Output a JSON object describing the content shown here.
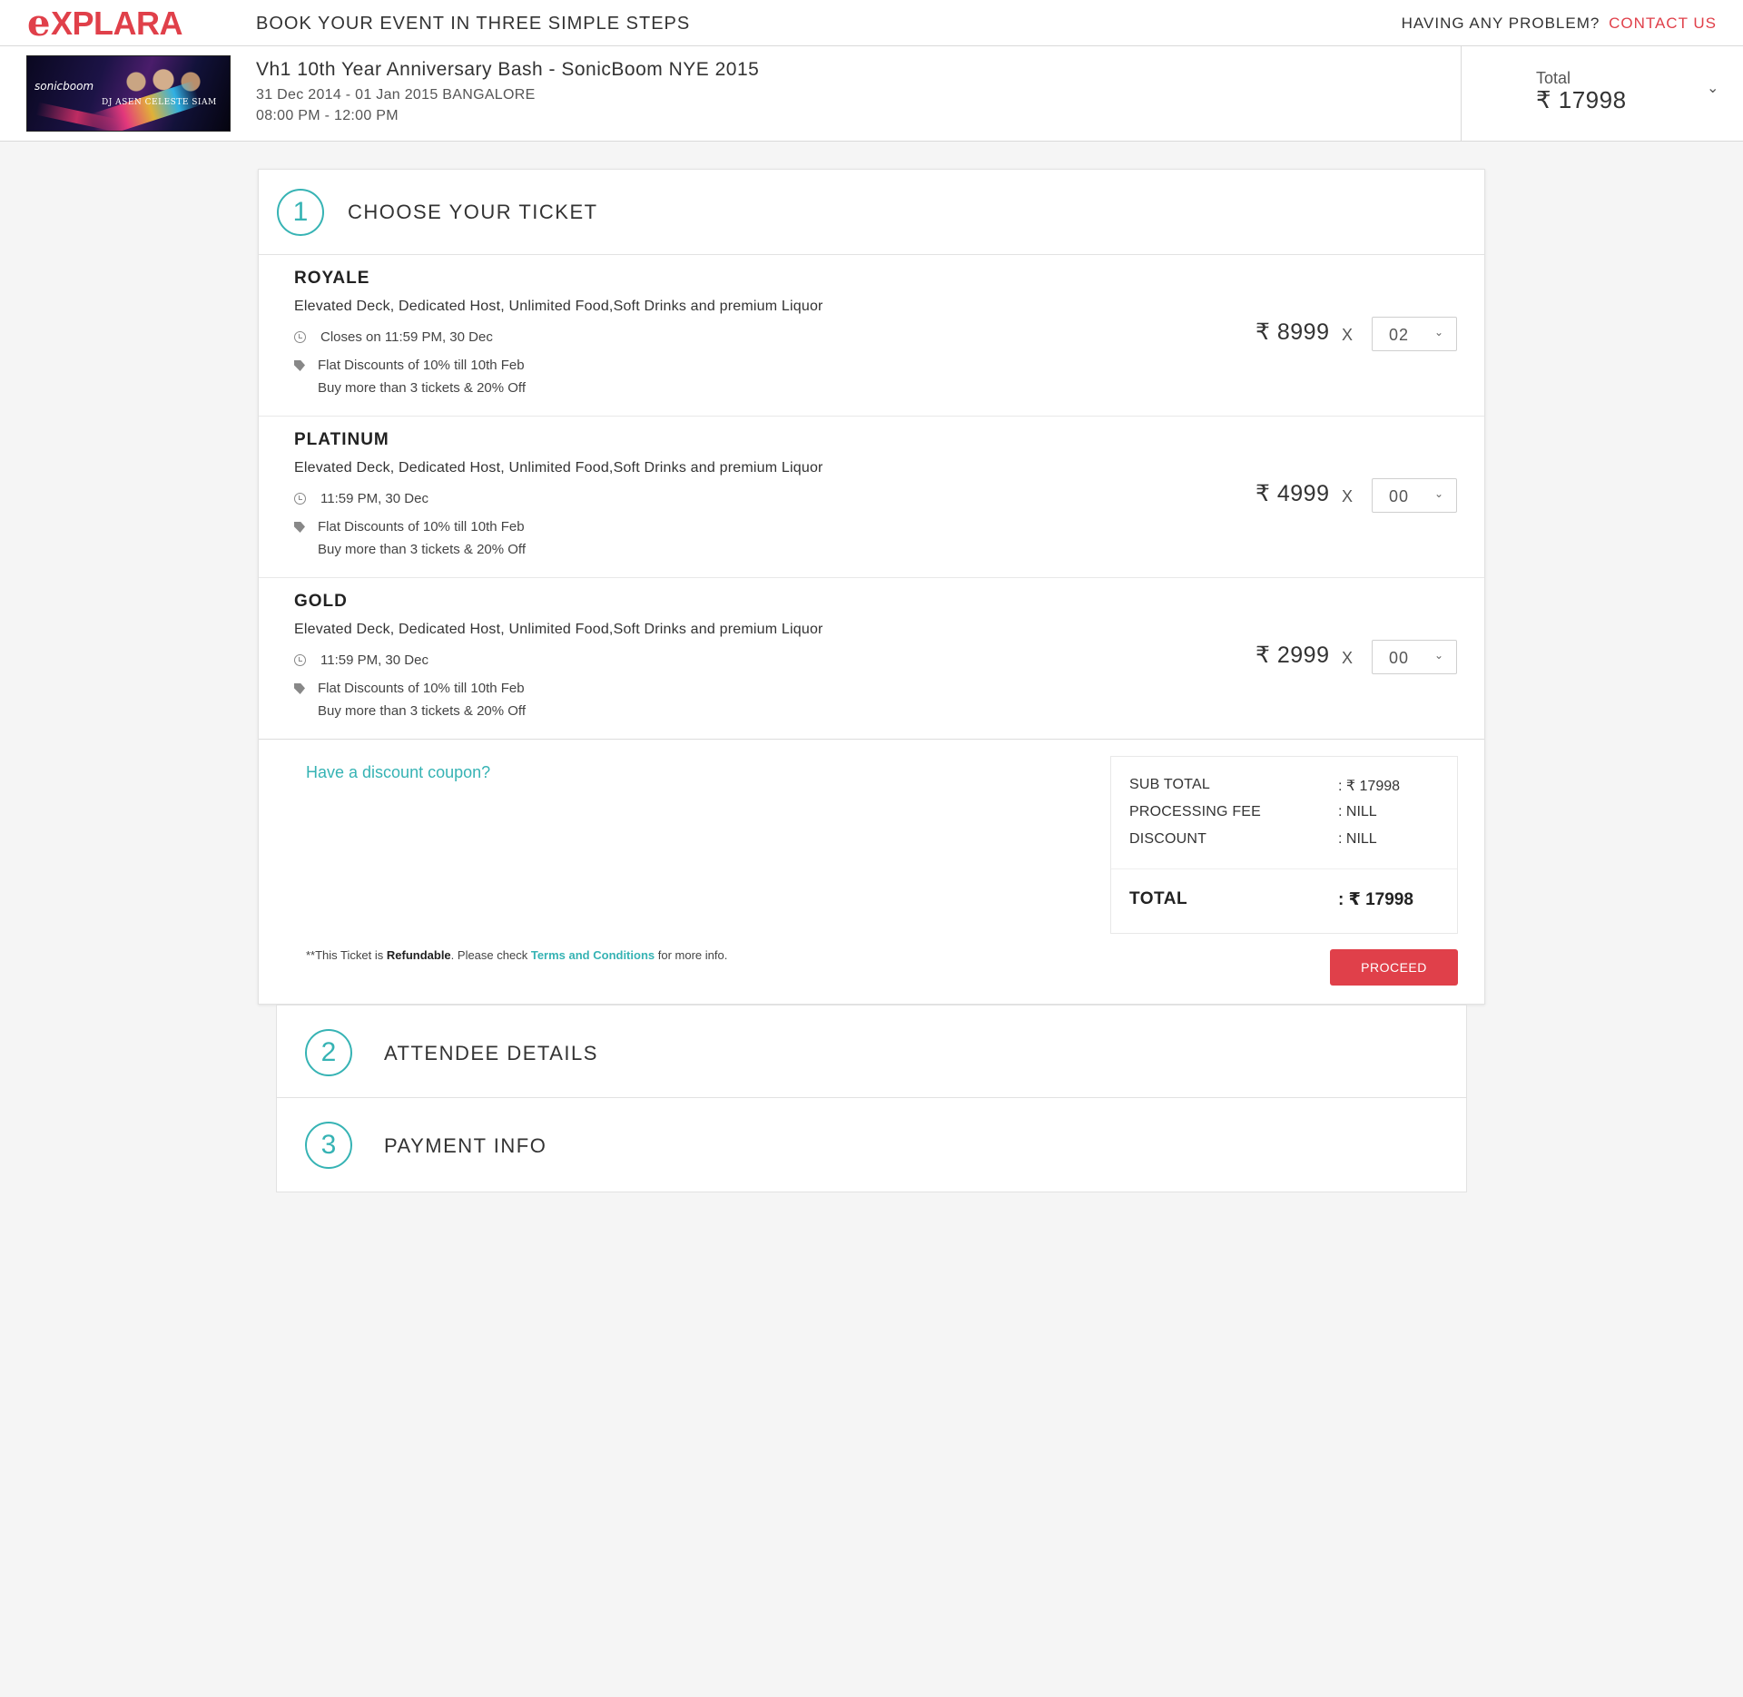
{
  "header": {
    "logo_text": "XPLARA",
    "logo_mark": "e",
    "steps_title": "BOOK YOUR EVENT IN THREE SIMPLE STEPS",
    "help_text": "HAVING ANY PROBLEM?",
    "contact_label": "CONTACT US"
  },
  "event": {
    "poster_brand": "sonicboom",
    "poster_artists": "DJ ASEN CELESTE SIAM",
    "title": "Vh1 10th Year Anniversary Bash - SonicBoom NYE 2015",
    "dates_location": "31 Dec 2014 - 01 Jan 2015 BANGALORE",
    "time": "08:00 PM - 12:00 PM",
    "total_label": "Total",
    "total_value": "₹ 17998"
  },
  "step1": {
    "number": "1",
    "title": "CHOOSE YOUR TICKET",
    "tickets": [
      {
        "name": "ROYALE",
        "description": "Elevated Deck, Dedicated Host, Unlimited Food,Soft Drinks and premium Liquor",
        "closes": "Closes on 11:59 PM, 30 Dec",
        "offer_1": "Flat Discounts of 10% till 10th Feb",
        "offer_2": "Buy more than 3 tickets & 20% Off",
        "price": "₹ 8999",
        "times": "X",
        "quantity": "02"
      },
      {
        "name": "PLATINUM",
        "description": "Elevated Deck, Dedicated Host, Unlimited Food,Soft Drinks and premium Liquor",
        "closes": "11:59 PM, 30 Dec",
        "offer_1": "Flat Discounts of 10% till 10th Feb",
        "offer_2": "Buy more than 3 tickets & 20% Off",
        "price": "₹ 4999",
        "times": "X",
        "quantity": "00"
      },
      {
        "name": "GOLD",
        "description": "Elevated Deck, Dedicated Host, Unlimited Food,Soft Drinks and premium Liquor",
        "closes": "11:59 PM, 30 Dec",
        "offer_1": "Flat Discounts of 10% till 10th Feb",
        "offer_2": "Buy more than 3 tickets & 20% Off",
        "price": "₹ 2999",
        "times": "X",
        "quantity": "00"
      }
    ],
    "coupon_link": "Have a discount coupon?",
    "summary": {
      "subtotal_label": "SUB TOTAL",
      "subtotal_value": ": ₹ 17998",
      "fee_label": "PROCESSING FEE",
      "fee_value": ": NILL",
      "discount_label": "DISCOUNT",
      "discount_value": ": NILL",
      "total_label": "TOTAL",
      "total_value": ": ₹ 17998"
    },
    "refund_prefix": "**This Ticket is",
    "refund_bold": "Refundable",
    "refund_mid": ". Please check",
    "refund_link": "Terms and Conditions",
    "refund_suffix": "for more info.",
    "proceed_label": "PROCEED"
  },
  "step2": {
    "number": "2",
    "title": "ATTENDEE DETAILS"
  },
  "step3": {
    "number": "3",
    "title": "PAYMENT INFO"
  },
  "colors": {
    "brand_red": "#e0404a",
    "accent_teal": "#36b3b4"
  },
  "icons": [
    "clock-icon",
    "tag-icon",
    "chevron-down-icon"
  ]
}
